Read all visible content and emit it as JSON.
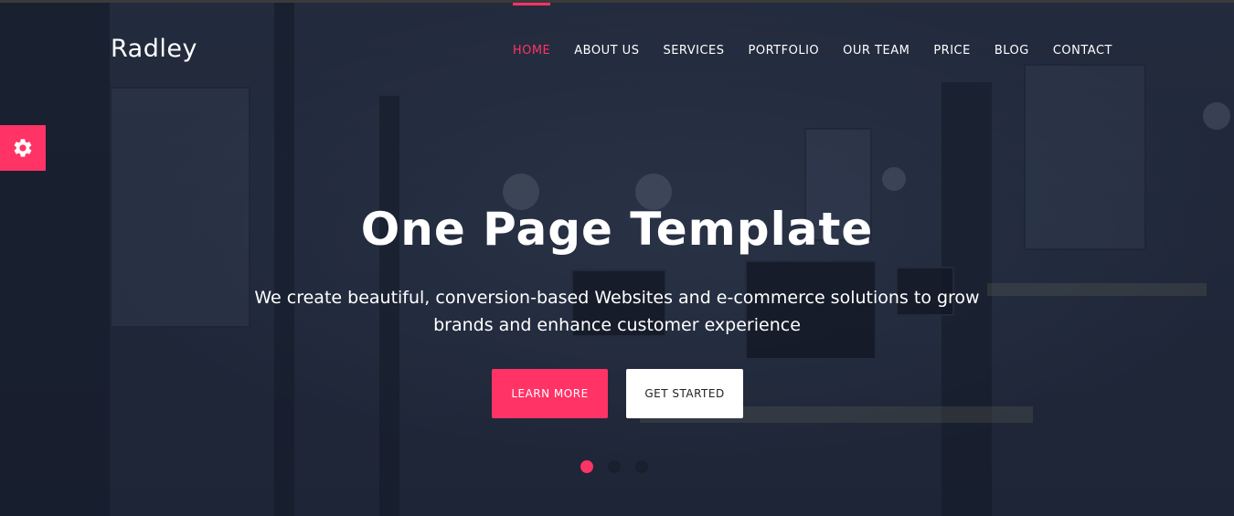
{
  "brand": {
    "logo_text": "Radley"
  },
  "nav": {
    "items": [
      {
        "label": "HOME",
        "active": true
      },
      {
        "label": "ABOUT US",
        "active": false
      },
      {
        "label": "SERVICES",
        "active": false
      },
      {
        "label": "PORTFOLIO",
        "active": false
      },
      {
        "label": "OUR TEAM",
        "active": false
      },
      {
        "label": "PRICE",
        "active": false
      },
      {
        "label": "BLOG",
        "active": false
      },
      {
        "label": "CONTACT",
        "active": false
      }
    ]
  },
  "settings": {
    "icon": "gear-icon"
  },
  "hero": {
    "title": "One Page Template",
    "subtitle": "We create beautiful, conversion-based Websites and e-commerce solutions to grow brands and enhance customer experience",
    "primary_button": "LEARN MORE",
    "secondary_button": "GET STARTED",
    "slides_total": 3,
    "active_slide": 1
  },
  "colors": {
    "accent": "#ff3366",
    "text": "#ffffff",
    "background": "#262f42"
  }
}
